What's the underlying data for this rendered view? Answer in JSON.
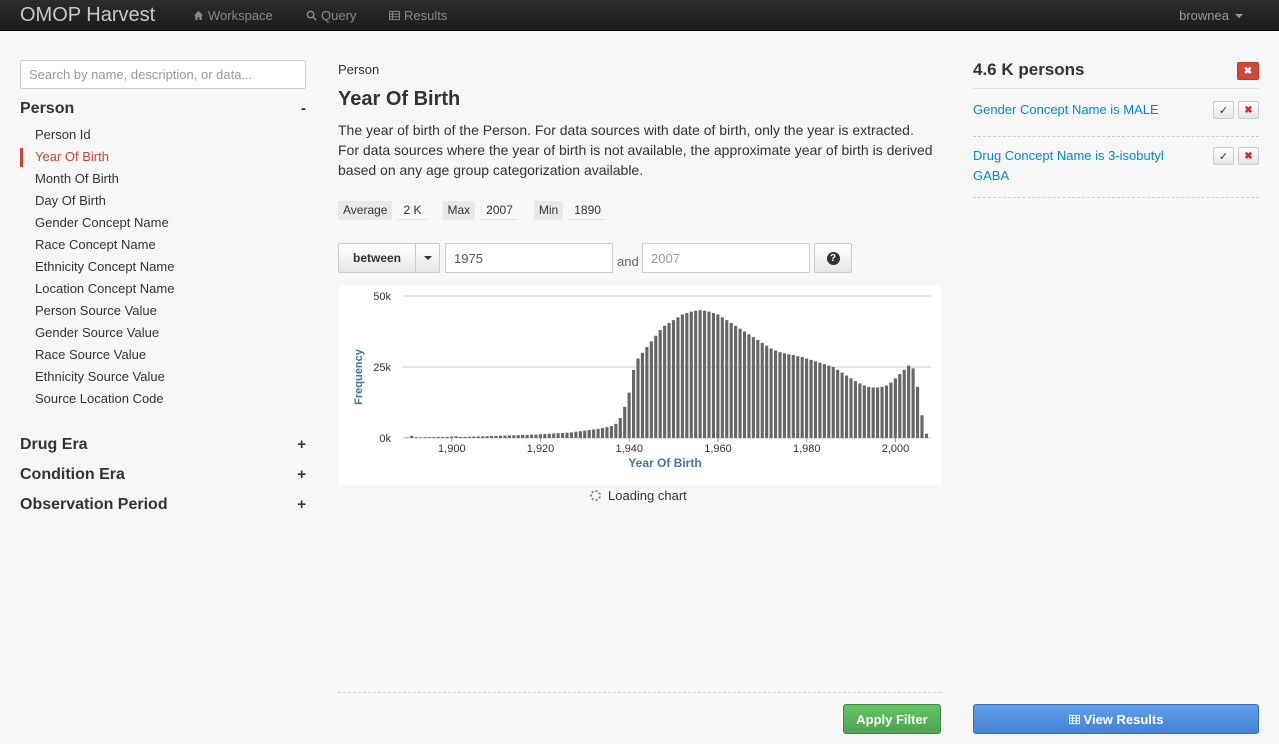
{
  "navbar": {
    "brand": "OMOP Harvest",
    "links": [
      {
        "label": "Workspace",
        "icon": "home-icon"
      },
      {
        "label": "Query",
        "icon": "search-icon"
      },
      {
        "label": "Results",
        "icon": "table-icon"
      }
    ],
    "user": "brownea"
  },
  "sidebar": {
    "search_placeholder": "Search by name, description, or data...",
    "categories": [
      {
        "name": "Person",
        "toggle": "-",
        "fields": [
          "Person Id",
          "Year Of Birth",
          "Month Of Birth",
          "Day Of Birth",
          "Gender Concept Name",
          "Race Concept Name",
          "Ethnicity Concept Name",
          "Location Concept Name",
          "Person Source Value",
          "Gender Source Value",
          "Race Source Value",
          "Ethnicity Source Value",
          "Source Location Code"
        ],
        "active_field": "Year Of Birth"
      },
      {
        "name": "Drug Era",
        "toggle": "+"
      },
      {
        "name": "Condition Era",
        "toggle": "+"
      },
      {
        "name": "Observation Period",
        "toggle": "+"
      }
    ]
  },
  "main": {
    "breadcrumb": "Person",
    "title": "Year Of Birth",
    "description": "The year of birth of the Person. For data sources with date of birth, only the year is extracted. For data sources where the year of birth is not available, the approximate year of birth is derived based on any age group categorization available.",
    "stats": {
      "average_label": "Average",
      "average_value": "2 K",
      "max_label": "Max",
      "max_value": "2007",
      "min_label": "Min",
      "min_value": "1890"
    },
    "filter": {
      "operator": "between",
      "value_low": "1975",
      "and_label": "and",
      "value_high_placeholder": "2007",
      "help": "?"
    },
    "loading_text": "Loading chart",
    "apply_label": "Apply Filter"
  },
  "chart_data": {
    "type": "bar",
    "xlabel": "Year Of Birth",
    "ylabel": "Frequency",
    "xlim": [
      1889,
      2008
    ],
    "ylim": [
      0,
      50000
    ],
    "x_ticks": [
      "1,900",
      "1,920",
      "1,940",
      "1,960",
      "1,980",
      "2,000"
    ],
    "y_ticks": [
      "0k",
      "25k",
      "50k"
    ],
    "grid": true,
    "color": "#666666",
    "x": [
      1890,
      1891,
      1892,
      1893,
      1894,
      1895,
      1896,
      1897,
      1898,
      1899,
      1900,
      1901,
      1902,
      1903,
      1904,
      1905,
      1906,
      1907,
      1908,
      1909,
      1910,
      1911,
      1912,
      1913,
      1914,
      1915,
      1916,
      1917,
      1918,
      1919,
      1920,
      1921,
      1922,
      1923,
      1924,
      1925,
      1926,
      1927,
      1928,
      1929,
      1930,
      1931,
      1932,
      1933,
      1934,
      1935,
      1936,
      1937,
      1938,
      1939,
      1940,
      1941,
      1942,
      1943,
      1944,
      1945,
      1946,
      1947,
      1948,
      1949,
      1950,
      1951,
      1952,
      1953,
      1954,
      1955,
      1956,
      1957,
      1958,
      1959,
      1960,
      1961,
      1962,
      1963,
      1964,
      1965,
      1966,
      1967,
      1968,
      1969,
      1970,
      1971,
      1972,
      1973,
      1974,
      1975,
      1976,
      1977,
      1978,
      1979,
      1980,
      1981,
      1982,
      1983,
      1984,
      1985,
      1986,
      1987,
      1988,
      1989,
      1990,
      1991,
      1992,
      1993,
      1994,
      1995,
      1996,
      1997,
      1998,
      1999,
      2000,
      2001,
      2002,
      2003,
      2004,
      2005,
      2006,
      2007
    ],
    "values": [
      200,
      800,
      300,
      250,
      280,
      300,
      320,
      340,
      360,
      380,
      500,
      600,
      350,
      400,
      450,
      500,
      550,
      600,
      650,
      700,
      750,
      800,
      850,
      900,
      950,
      1000,
      1050,
      1100,
      1150,
      1200,
      1300,
      1400,
      1500,
      1600,
      1700,
      1800,
      1900,
      2000,
      2200,
      2400,
      2600,
      2800,
      3000,
      3200,
      3500,
      3800,
      4200,
      5000,
      7000,
      11000,
      16000,
      24000,
      28000,
      30000,
      32000,
      34000,
      36000,
      38000,
      39500,
      40500,
      41500,
      42500,
      43500,
      44000,
      44500,
      44800,
      45000,
      44800,
      44500,
      44000,
      43500,
      42500,
      41500,
      40500,
      39500,
      38500,
      37500,
      36500,
      35500,
      34500,
      33500,
      32500,
      31500,
      30800,
      30200,
      29800,
      29500,
      29200,
      28800,
      28500,
      28000,
      27500,
      27000,
      26500,
      26000,
      25500,
      25000,
      24000,
      23000,
      22000,
      21000,
      20000,
      19200,
      18500,
      18000,
      17800,
      17800,
      18000,
      18500,
      19500,
      21000,
      22500,
      24000,
      25500,
      24500,
      18000,
      8000,
      1500
    ]
  },
  "right": {
    "count": "4.6 K persons",
    "contexts": [
      {
        "text": "Gender Concept Name is MALE"
      },
      {
        "text": "Drug Concept Name is 3-isobutyl GABA"
      }
    ],
    "view_results_label": "View Results",
    "accent": "#4683d6",
    "danger": "#d14836",
    "success": "#51a351"
  }
}
